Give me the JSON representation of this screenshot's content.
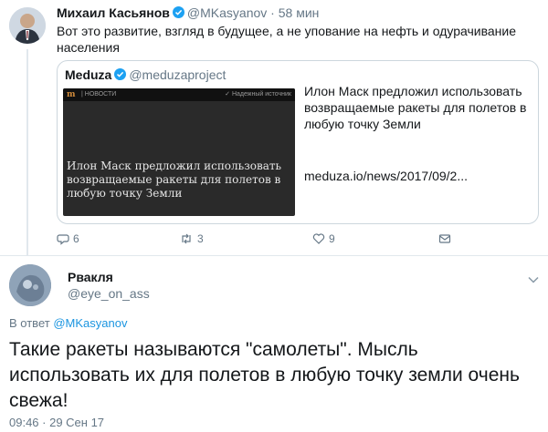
{
  "parent": {
    "name": "Михаил Касьянов",
    "handle": "@MKasyanov",
    "separator": "·",
    "time": "58 мин",
    "text": "Вот это развитие, взгляд в будущее, а не упование на нефть и одурачивание населения",
    "quote": {
      "name": "Meduza",
      "handle": "@meduzaproject",
      "image": {
        "logo": "m",
        "section": "| НОВОСТИ",
        "source": "✓ Надежный источник",
        "title": "Илон Маск предложил использовать возвращаемые ракеты для полетов в любую точку Земли"
      },
      "summary": "Илон Маск предложил использовать возвращаемые ракеты для полетов в любую точку Земли",
      "link": "meduza.io/news/2017/09/2..."
    },
    "actions": {
      "replies": "6",
      "retweets": "3",
      "likes": "9"
    }
  },
  "reply": {
    "name": "Рвакля",
    "handle": "@eye_on_ass",
    "in_reply_prefix": "В ответ",
    "in_reply_mention": "@MKasyanov",
    "text": "Такие ракеты называются \"самолеты\". Мысль использовать их для полетов в любую точку земли очень свежа!",
    "timestamp": "09:46 · 29 Сен 17"
  },
  "colors": {
    "verified": "#1da1f2",
    "link": "#1b95e0",
    "muted": "#657786",
    "text": "#14171a",
    "border": "#ccd6dd"
  }
}
